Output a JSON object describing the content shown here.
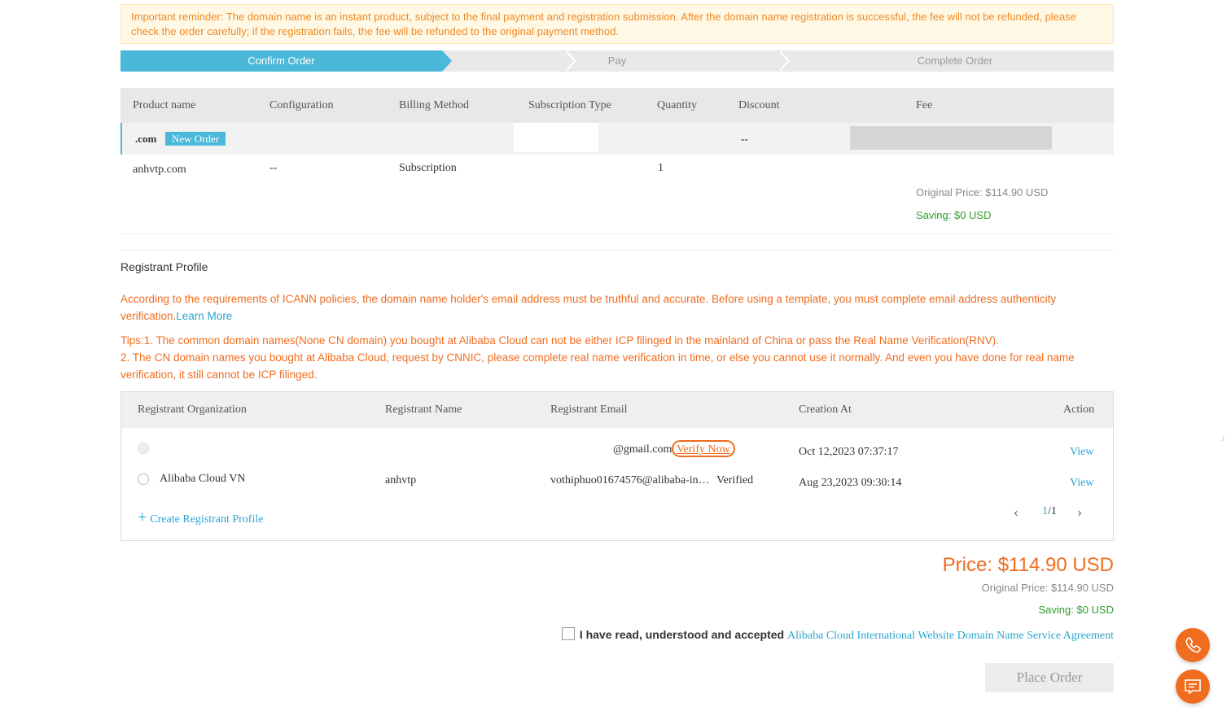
{
  "reminder": "Important reminder: The domain name is an instant product, subject to the final payment and registration submission. After the domain name registration is successful, the fee will not be refunded, please check the order carefully; if the registration fails, the fee will be refunded to the original payment method.",
  "steps": [
    "Confirm Order",
    "Pay",
    "Complete Order"
  ],
  "order_table": {
    "headers": [
      "Product name",
      "Configuration",
      "Billing Method",
      "Subscription Type",
      "Quantity",
      "Discount",
      "Fee"
    ],
    "group": {
      "suffix": ".com",
      "badge": "New Order",
      "discount": "--"
    },
    "row": {
      "product": "anhvtp.com",
      "configuration": "--",
      "billing": "Subscription",
      "quantity": "1"
    },
    "fee_original": "Original Price: $114.90  USD",
    "fee_saving": "Saving: $0  USD"
  },
  "registrant": {
    "title": "Registrant Profile",
    "icann_notice": "According to the requirements of ICANN policies, the domain name holder's email address must be truthful and accurate. Before using a template, you must complete email address authenticity verification.",
    "learn_more": "Learn More",
    "tips_1": "Tips:1. The common domain names(None CN domain) you bought at Alibaba Cloud can not be either ICP filinged in the mainland of China or pass the Real Name Verification(RNV).",
    "tips_2": "2. The CN domain names you bought at Alibaba Cloud, request by CNNIC, please complete real name verification in time, or else you cannot use it normally. And even you have done for real name verification, it still cannot be ICP filinged.",
    "headers": [
      "Registrant Organization",
      "Registrant Name",
      "Registrant Email",
      "Creation At",
      "Action"
    ],
    "rows": [
      {
        "org": "",
        "name": "",
        "email": "@gmail.com",
        "status": "Verify Now",
        "created": "Oct 12,2023 07:37:17",
        "action": "View"
      },
      {
        "org": "Alibaba Cloud VN",
        "name": "anhvtp",
        "email": "vothiphuo01674576@alibaba-in…",
        "status": "Verified",
        "created": "Aug 23,2023 09:30:14",
        "action": "View"
      }
    ],
    "create_label": "Create Registrant Profile",
    "page_current": "1",
    "page_total": "/1"
  },
  "summary": {
    "price": "Price: $114.90 USD",
    "original": "Original Price: $114.90  USD",
    "saving": "Saving: $0  USD",
    "agree_text": "I have read, understood and accepted",
    "agree_link": "Alibaba Cloud International Website Domain Name Service Agreement",
    "place_order": "Place Order"
  },
  "icons": {
    "phone": "phone-icon",
    "chat": "chat-icon"
  },
  "colors": {
    "accent": "#4ab8d9",
    "warning": "#f06c1e",
    "success": "#2e9e2e"
  }
}
